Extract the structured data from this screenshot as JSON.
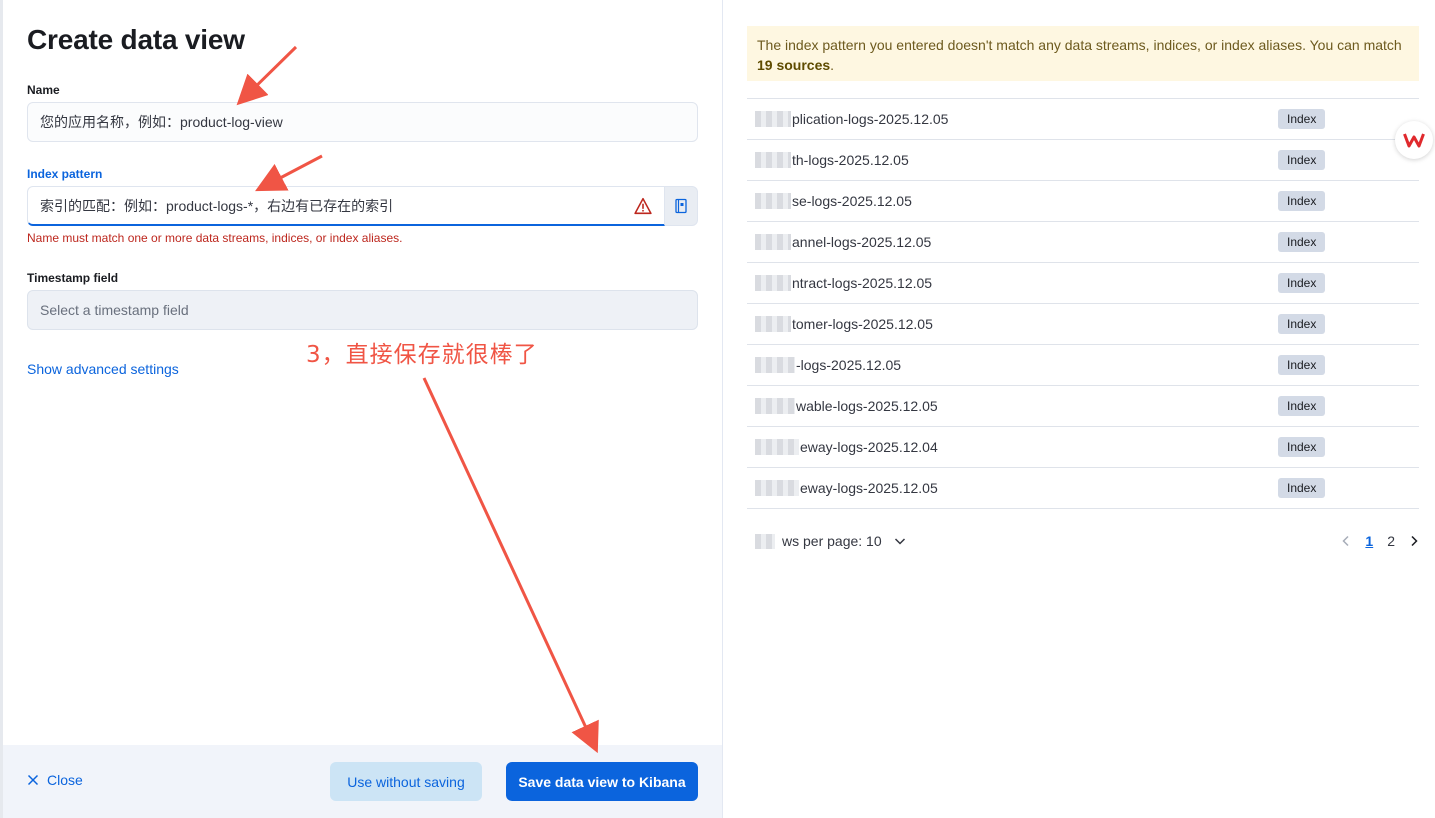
{
  "flyout": {
    "title": "Create data view",
    "name_label": "Name",
    "name_value": "您的应用名称，例如：product-log-view",
    "index_label": "Index pattern",
    "index_value": "索引的匹配：例如：product-logs-*，右边有已存在的索引",
    "index_error": "Name must match one or more data streams, indices, or index aliases.",
    "timestamp_label": "Timestamp field",
    "timestamp_placeholder": "Select a timestamp field",
    "advanced_link": "Show advanced settings"
  },
  "footer": {
    "close_label": "Close",
    "use_without_saving": "Use without saving",
    "save_label": "Save data view to Kibana"
  },
  "annotation": {
    "text": "3，直接保存就很棒了",
    "color": "#f05545"
  },
  "callout": {
    "text_before": "The index pattern you entered doesn't match any data streams, indices, or index aliases. You can match ",
    "count": "19 sources",
    "text_after": "."
  },
  "indices": [
    {
      "name": "plication-logs-2025.12.05",
      "type": "Index"
    },
    {
      "name": "th-logs-2025.12.05",
      "type": "Index"
    },
    {
      "name": "se-logs-2025.12.05",
      "type": "Index"
    },
    {
      "name": "annel-logs-2025.12.05",
      "type": "Index"
    },
    {
      "name": "ntract-logs-2025.12.05",
      "type": "Index"
    },
    {
      "name": "tomer-logs-2025.12.05",
      "type": "Index"
    },
    {
      "name": "-logs-2025.12.05",
      "type": "Index"
    },
    {
      "name": "wable-logs-2025.12.05",
      "type": "Index"
    },
    {
      "name": "eway-logs-2025.12.04",
      "type": "Index"
    },
    {
      "name": "eway-logs-2025.12.05",
      "type": "Index"
    }
  ],
  "pager": {
    "rows_per_page": "ws per page: 10",
    "pages": [
      "1",
      "2"
    ],
    "current": "1"
  },
  "colors": {
    "accent": "#0b64dd",
    "error": "#bd271e",
    "callout_bg": "#fef7e1"
  }
}
